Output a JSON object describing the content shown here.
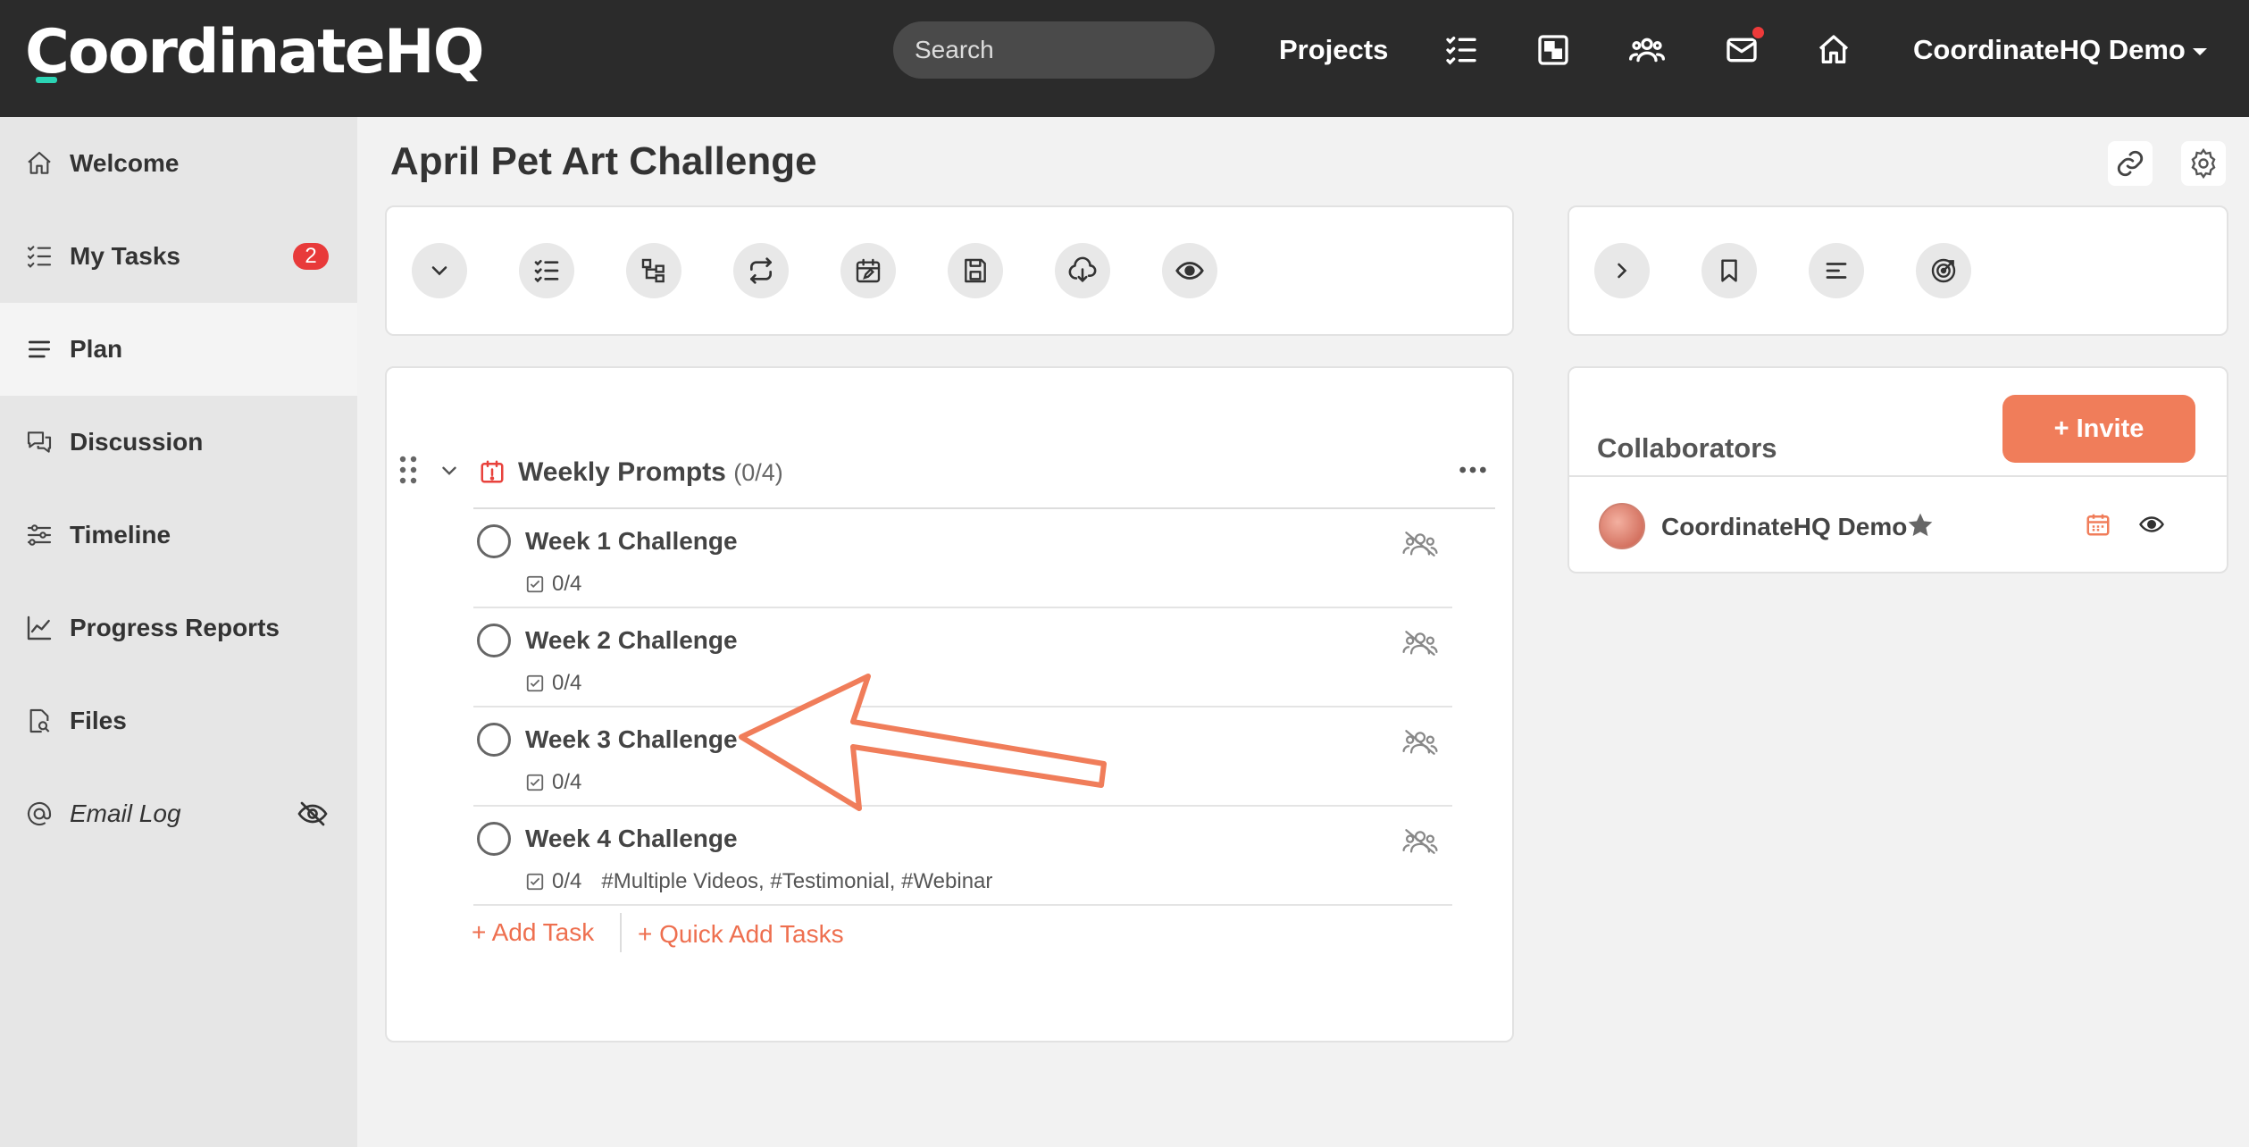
{
  "app": {
    "logo": "CoordinateHQ",
    "brand_accent": "#2bd4b4",
    "accent": "#f07d5a"
  },
  "topbar": {
    "search_placeholder": "Search",
    "projects_label": "Projects",
    "user_label": "CoordinateHQ Demo",
    "icons": [
      "tasks-icon",
      "board-icon",
      "people-icon",
      "mail-icon",
      "home-icon"
    ]
  },
  "sidebar": {
    "items": [
      {
        "label": "Welcome",
        "icon": "home-icon"
      },
      {
        "label": "My Tasks",
        "icon": "checklist-icon",
        "badge": "2"
      },
      {
        "label": "Plan",
        "icon": "lines-icon",
        "active": true
      },
      {
        "label": "Discussion",
        "icon": "chat-icon"
      },
      {
        "label": "Timeline",
        "icon": "sliders-icon"
      },
      {
        "label": "Progress Reports",
        "icon": "chart-icon"
      },
      {
        "label": "Files",
        "icon": "file-search-icon"
      },
      {
        "label": "Email Log",
        "icon": "at-icon",
        "trailing_icon": "eye-slash-icon"
      }
    ]
  },
  "main": {
    "title": "April Pet Art Challenge",
    "toolbar_icons": [
      "chevron-down-icon",
      "checklist-icon",
      "hierarchy-icon",
      "repeat-icon",
      "calendar-edit-icon",
      "save-icon",
      "cloud-download-icon",
      "eye-icon"
    ],
    "group": {
      "title": "Weekly Prompts",
      "count": "(0/4)",
      "tasks": [
        {
          "title": "Week 1 Challenge",
          "progress": "0/4",
          "tags": ""
        },
        {
          "title": "Week 2 Challenge",
          "progress": "0/4",
          "tags": ""
        },
        {
          "title": "Week 3 Challenge",
          "progress": "0/4",
          "tags": ""
        },
        {
          "title": "Week 4 Challenge",
          "progress": "0/4",
          "tags": "#Multiple Videos, #Testimonial, #Webinar"
        }
      ],
      "add_task": "+ Add Task",
      "quick_add": "+ Quick Add Tasks"
    }
  },
  "right_panel": {
    "toolbar_icons": [
      "chevron-right-icon",
      "bookmark-icon",
      "align-left-icon",
      "target-icon"
    ],
    "collaborators_title": "Collaborators",
    "invite_label": "+ Invite",
    "collaborators": [
      {
        "name": "CoordinateHQ Demo"
      }
    ]
  }
}
